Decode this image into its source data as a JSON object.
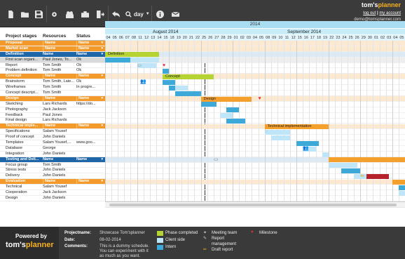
{
  "toolbar": {
    "zoom_label": "day",
    "logo_text": "tom's",
    "logo_accent": "planner",
    "logout": "log out",
    "account": "my account",
    "separator": "|",
    "email": "demo@tomsplanner.com"
  },
  "columns": {
    "stages": "Project stages",
    "resources": "Resources",
    "status": "Status"
  },
  "timeline": {
    "year": "2014",
    "months": [
      "August 2014",
      "September 2014"
    ],
    "days": [
      "04",
      "05",
      "06",
      "07",
      "08",
      "11",
      "12",
      "13",
      "14",
      "15",
      "18",
      "19",
      "20",
      "21",
      "22",
      "25",
      "26",
      "27",
      "28",
      "29",
      "01",
      "02",
      "03",
      "04",
      "05",
      "08",
      "09",
      "10",
      "11",
      "12",
      "15",
      "16",
      "17",
      "18",
      "19",
      "22",
      "23",
      "24",
      "25",
      "26",
      "29",
      "30",
      "01",
      "02",
      "03",
      "04",
      "05"
    ]
  },
  "rows": [
    {
      "type": "head-orange",
      "stage": "Proposal",
      "resource": "Name",
      "status": "Name"
    },
    {
      "type": "head-orange",
      "stage": "Market scan",
      "resource": "Name",
      "status": "Name"
    },
    {
      "type": "head-blue",
      "stage": "Definition",
      "resource": "Name",
      "status": "Name"
    },
    {
      "type": "selected",
      "stage": "First scan organi...",
      "resource": "Paul Jones, To...",
      "status": "Ok"
    },
    {
      "type": "plain",
      "stage": "Report",
      "resource": "Tom Smith",
      "status": "Ok"
    },
    {
      "type": "plain",
      "stage": "Problem definition",
      "resource": "Tom Smith",
      "status": "Ok"
    },
    {
      "type": "head-orange",
      "stage": "Concept",
      "resource": "Name",
      "status": "Name"
    },
    {
      "type": "plain",
      "stage": "Brainstorm",
      "resource": "Tom Smith, Late...",
      "status": "Ok"
    },
    {
      "type": "plain",
      "stage": "Wireframes",
      "resource": "Tom Smith",
      "status": "In progre..."
    },
    {
      "type": "plain",
      "stage": "Concept descript...",
      "resource": "Tom Smith",
      "status": ""
    },
    {
      "type": "head-orange",
      "stage": "Design",
      "resource": "Name",
      "status": "Name"
    },
    {
      "type": "plain",
      "stage": "Sketching",
      "resource": "Lars Richards",
      "status": "https://do..."
    },
    {
      "type": "plain",
      "stage": "Photography",
      "resource": "Jack Jackson",
      "status": ""
    },
    {
      "type": "plain",
      "stage": "Feedback",
      "resource": "Paul Jones",
      "status": ""
    },
    {
      "type": "plain",
      "stage": "Final design",
      "resource": "Lars Richards",
      "status": ""
    },
    {
      "type": "head-orange",
      "stage": "Technical imple...",
      "resource": "Name",
      "status": "Name"
    },
    {
      "type": "plain",
      "stage": "Specifications",
      "resource": "Salam Yousef",
      "status": ""
    },
    {
      "type": "plain",
      "stage": "Proof of concept",
      "resource": "John Daniels",
      "status": ""
    },
    {
      "type": "plain",
      "stage": "Templates",
      "resource": "Salam Yousef,...",
      "status": "www.goo..."
    },
    {
      "type": "plain",
      "stage": "Database",
      "resource": "George",
      "status": ""
    },
    {
      "type": "plain",
      "stage": "Integration",
      "resource": "John Daniels",
      "status": ""
    },
    {
      "type": "head-blue",
      "stage": "Testing and Deli...",
      "resource": "Name",
      "status": "Name"
    },
    {
      "type": "plain",
      "stage": "Focus group",
      "resource": "Tom Smith",
      "status": ""
    },
    {
      "type": "plain",
      "stage": "Stress tests",
      "resource": "John Daniels",
      "status": ""
    },
    {
      "type": "plain",
      "stage": "Delivery",
      "resource": "John Daniels",
      "status": ""
    },
    {
      "type": "head-orange",
      "stage": "Evaluation",
      "resource": "Name",
      "status": "Name"
    },
    {
      "type": "plain",
      "stage": "Technical",
      "resource": "Salam Yousef",
      "status": ""
    },
    {
      "type": "plain",
      "stage": "Cooperation",
      "resource": "Jack Jackson",
      "status": ""
    },
    {
      "type": "plain",
      "stage": "Design",
      "resource": "John Daniels",
      "status": ""
    }
  ],
  "bars": [
    {
      "label": "Definition",
      "color": "green"
    },
    {
      "label": "Concept",
      "color": "green"
    },
    {
      "label": "Design",
      "color": "orange"
    },
    {
      "label": "Technical implementation",
      "color": "orange"
    }
  ],
  "footer": {
    "powered": "Powered by",
    "brand": "tom's",
    "brand_accent": "planner",
    "projectname_label": "Projectname:",
    "projectname": "Showcase Tom'splanner",
    "date_label": "Date:",
    "date": "08-02-2014",
    "comments_label": "Comments:",
    "comments": [
      "This is a dummy schedule.",
      "You can experiment with it",
      "as much as you want."
    ],
    "legend": [
      {
        "label": "Phase completed",
        "color": "#b6d334"
      },
      {
        "label": "Client side",
        "color": "#bfe6f8"
      },
      {
        "label": "Intern",
        "color": "#3ca9d9"
      }
    ],
    "icons": [
      {
        "label": "Meeting team"
      },
      {
        "label": "Report"
      },
      {
        "label": "management"
      },
      {
        "label": "Draft report"
      },
      {
        "label": "Milestone"
      }
    ]
  }
}
